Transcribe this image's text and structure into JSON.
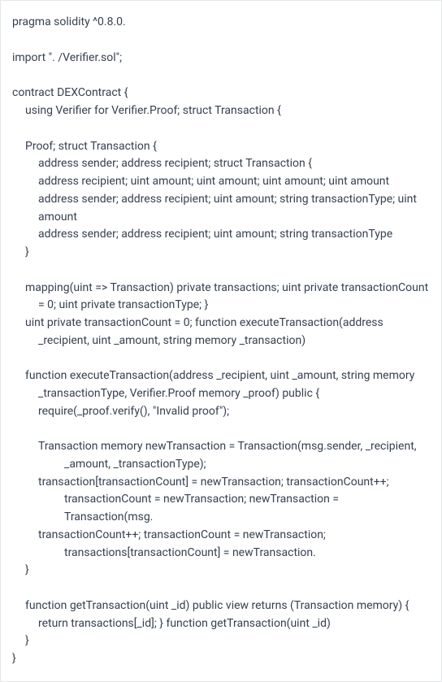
{
  "code": {
    "l1": "pragma solidity ^0.8.0.",
    "l2": "import \". /Verifier.sol\";",
    "l3": "contract DEXContract {",
    "l4": "using Verifier for Verifier.Proof; struct Transaction {",
    "l5": "Proof; struct Transaction {",
    "l6": "address sender; address recipient; struct Transaction {",
    "l7": "address recipient; uint amount; uint amount; uint amount; uint amount",
    "l8": "address sender; address recipient; uint amount; string transactionType; uint amount",
    "l9": "address sender; address recipient; uint amount; string transactionType",
    "l10": "}",
    "l11": "mapping(uint => Transaction) private transactions; uint private transactionCount = 0; uint private transactionType; }",
    "l12": "uint private transactionCount = 0; function executeTransaction(address _recipient, uint _amount, string memory _transaction)",
    "l13": "function executeTransaction(address _recipient, uint _amount, string memory _transactionType, Verifier.Proof memory _proof) public {",
    "l14": "require(_proof.verify(), \"Invalid proof\");",
    "l15": "Transaction memory newTransaction = Transaction(msg.sender, _recipient, _amount, _transactionType);",
    "l16": "transaction[transactionCount] = newTransaction; transactionCount++; transactionCount = newTransaction; newTransaction = Transaction(msg.",
    "l17": "transactionCount++; transactionCount = newTransaction; transactions[transactionCount] = newTransaction.",
    "l18": "}",
    "l19": "function getTransaction(uint _id) public view returns (Transaction memory) {",
    "l20": "return transactions[_id]; } function getTransaction(uint _id)",
    "l21": "}",
    "l22": "}"
  }
}
